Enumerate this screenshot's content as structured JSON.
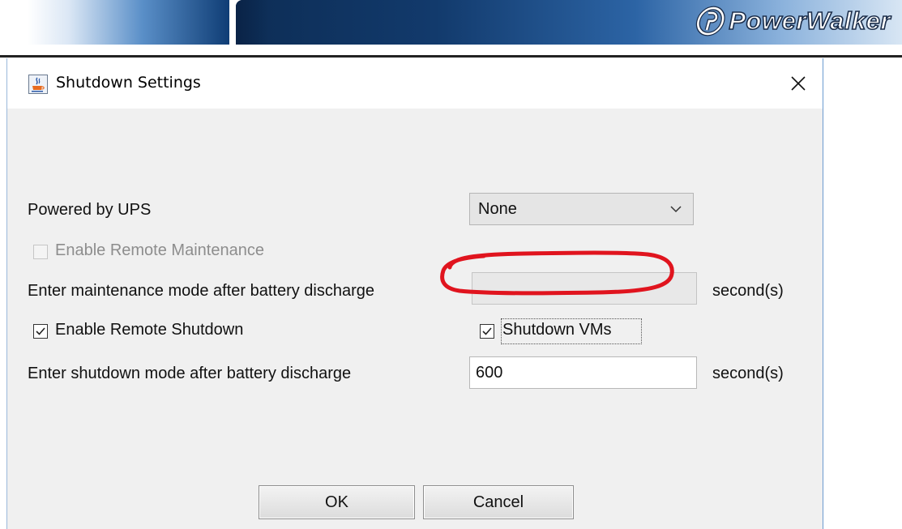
{
  "branding": {
    "logo_text": "PowerWalker",
    "colors": {
      "banner_dark": "#0d2d55",
      "banner_light": "#d8e6f4"
    }
  },
  "dialog": {
    "title": "Shutdown Settings",
    "app_icon": "java-cup-icon",
    "close_icon": "close-icon"
  },
  "form": {
    "powered_by_label": "Powered by UPS",
    "powered_by_value": "None",
    "enable_remote_maintenance_label": "Enable Remote Maintenance",
    "enable_remote_maintenance_checked": false,
    "enable_remote_maintenance_enabled": false,
    "maintenance_after_label": "Enter maintenance mode after battery discharge",
    "maintenance_after_value": "",
    "maintenance_unit": "second(s)",
    "enable_remote_shutdown_label": "Enable Remote Shutdown",
    "enable_remote_shutdown_checked": true,
    "shutdown_vms_label": "Shutdown VMs",
    "shutdown_vms_checked": true,
    "shutdown_after_label": "Enter shutdown mode after battery discharge",
    "shutdown_after_value": "600",
    "shutdown_unit": "second(s)"
  },
  "annotation": {
    "color": "#e0141e"
  },
  "buttons": {
    "ok": "OK",
    "cancel": "Cancel"
  }
}
